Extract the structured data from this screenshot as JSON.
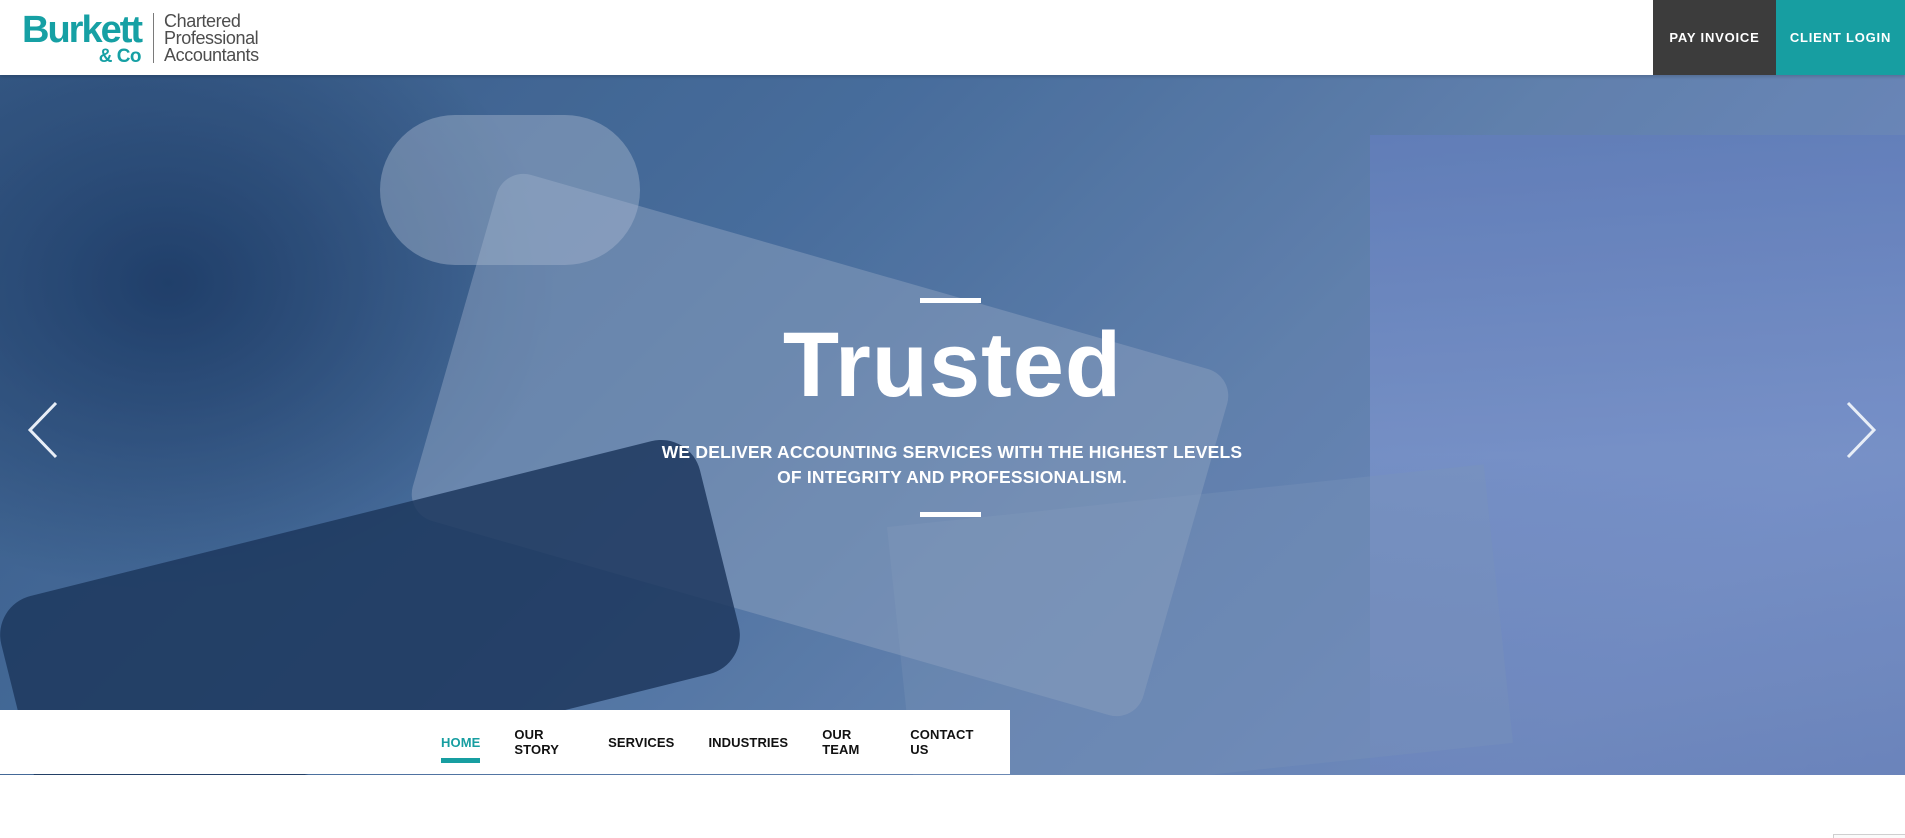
{
  "header": {
    "logo": {
      "name": "Burkett",
      "co": "& Co",
      "tagline": [
        "Chartered",
        "Professional",
        "Accountants"
      ]
    },
    "pay_invoice_label": "PAY INVOICE",
    "client_login_label": "CLIENT LOGIN"
  },
  "hero": {
    "title": "Trusted",
    "subtitle": "WE DELIVER ACCOUNTING SERVICES WITH THE HIGHEST LEVELS OF INTEGRITY AND PROFESSIONALISM.",
    "prev_icon": "chevron-left-icon",
    "next_icon": "chevron-right-icon"
  },
  "nav": {
    "items": [
      {
        "label": "HOME",
        "active": true
      },
      {
        "label": "OUR STORY",
        "active": false
      },
      {
        "label": "SERVICES",
        "active": false
      },
      {
        "label": "INDUSTRIES",
        "active": false
      },
      {
        "label": "OUR TEAM",
        "active": false
      },
      {
        "label": "CONTACT US",
        "active": false
      }
    ]
  },
  "colors": {
    "brand_teal": "#179ea1",
    "pay_button_bg": "#3c3c3c",
    "hero_overlay": "#4a6d9a"
  }
}
